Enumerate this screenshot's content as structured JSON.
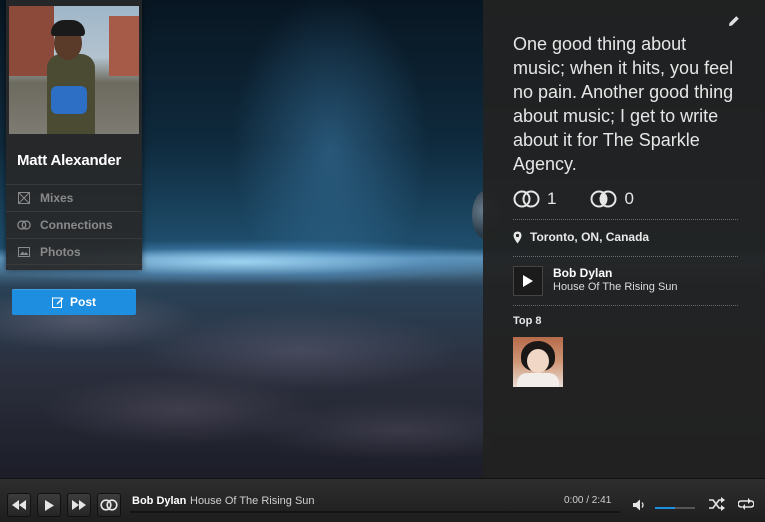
{
  "profile": {
    "name": "Matt Alexander",
    "nav": [
      {
        "label": "Mixes",
        "icon": "mixes-icon"
      },
      {
        "label": "Connections",
        "icon": "connections-icon"
      },
      {
        "label": "Photos",
        "icon": "photos-icon"
      }
    ],
    "post_label": "Post"
  },
  "info": {
    "bio": "One good thing about music; when it hits, you feel no pain. Another good thing about music; I get to write about it for The Sparkle Agency.",
    "connections_in": "1",
    "connections_out": "0",
    "location": "Toronto, ON, Canada",
    "track": {
      "artist": "Bob Dylan",
      "title": "House Of The Rising Sun"
    },
    "top8_label": "Top 8"
  },
  "player": {
    "artist": "Bob Dylan",
    "title": "House Of The Rising Sun",
    "time": "0:00 / 2:41",
    "progress": 0,
    "volume": 0.5
  },
  "colors": {
    "accent": "#1e8fe0",
    "panel": "#222222"
  }
}
